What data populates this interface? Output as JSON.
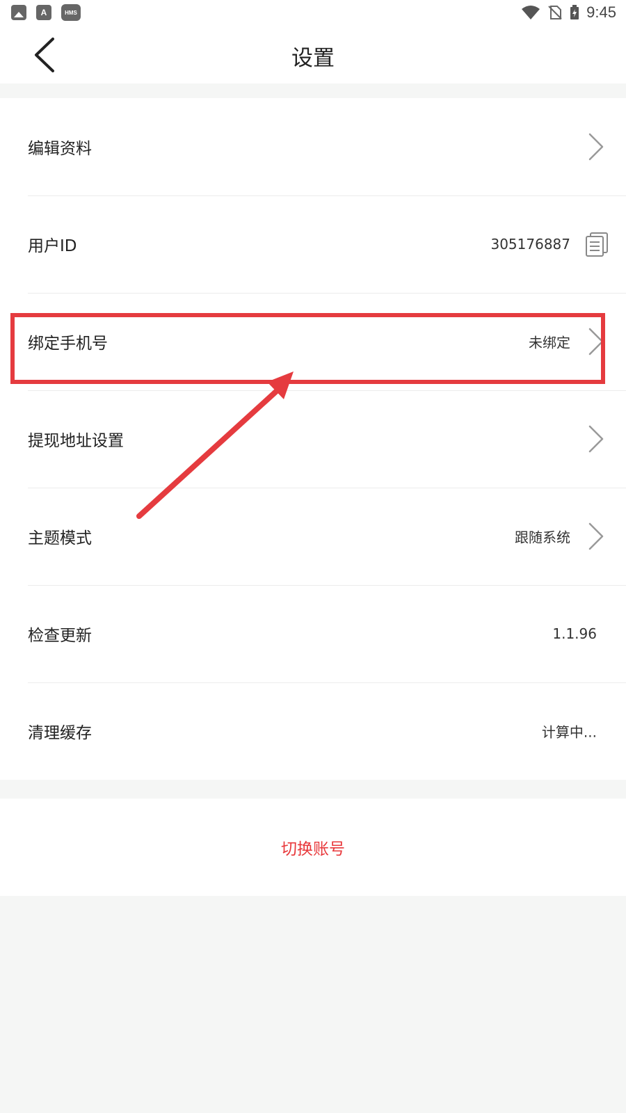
{
  "status_bar": {
    "time": "9:45",
    "hms_label": "HMS",
    "a_label": "A",
    "icons": [
      "gallery-icon",
      "a-icon",
      "hms-icon",
      "wifi-icon",
      "no-sim-icon",
      "battery-charging-icon"
    ]
  },
  "header": {
    "title": "设置",
    "back_icon": "chevron-left-icon"
  },
  "settings": {
    "items": [
      {
        "label": "编辑资料",
        "value": "",
        "trailing": "chevron-right-icon"
      },
      {
        "label": "用户ID",
        "value": "305176887",
        "trailing": "copy-icon"
      },
      {
        "label": "绑定手机号",
        "value": "未绑定",
        "trailing": "chevron-right-icon"
      },
      {
        "label": "提现地址设置",
        "value": "",
        "trailing": "chevron-right-icon"
      },
      {
        "label": "主题模式",
        "value": "跟随系统",
        "trailing": "chevron-right-icon"
      },
      {
        "label": "检查更新",
        "value": "1.1.96",
        "trailing": ""
      },
      {
        "label": "清理缓存",
        "value": "计算中...",
        "trailing": ""
      }
    ]
  },
  "switch_account": {
    "label": "切换账号"
  },
  "colors": {
    "accent_red": "#e8383b",
    "annotation_red": "#e53b3f",
    "background": "#f5f6f5",
    "surface": "#ffffff"
  }
}
